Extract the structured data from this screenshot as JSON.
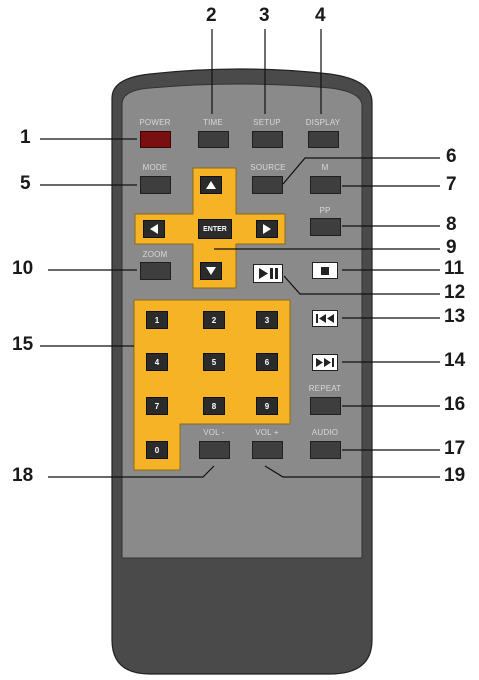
{
  "remote": {
    "buttons": {
      "power": "POWER",
      "time": "TIME",
      "setup": "SETUP",
      "display": "DISPLAY",
      "mode": "MODE",
      "source": "SOURCE",
      "m": "M",
      "pp": "PP",
      "zoom": "ZOOM",
      "enter": "ENTER",
      "repeat": "REPEAT",
      "audio": "AUDIO",
      "vol_minus": "VOL -",
      "vol_plus": "VOL +"
    },
    "keypad": [
      "1",
      "2",
      "3",
      "4",
      "5",
      "6",
      "7",
      "8",
      "9",
      "0"
    ],
    "icons": {
      "up": "arrow-up-icon",
      "down": "arrow-down-icon",
      "left": "arrow-left-icon",
      "right": "arrow-right-icon",
      "play_pause": "play-pause-icon",
      "stop": "stop-icon",
      "prev": "previous-track-icon",
      "next": "next-track-icon"
    },
    "colors": {
      "body": "#4a4a4a",
      "face": "#8a8a8a",
      "accent": "#f5b325",
      "power": "#7a0f12"
    }
  },
  "callouts": {
    "n1": "1",
    "n2": "2",
    "n3": "3",
    "n4": "4",
    "n5": "5",
    "n6": "6",
    "n7": "7",
    "n8": "8",
    "n9": "9",
    "n10": "10",
    "n11": "11",
    "n12": "12",
    "n13": "13",
    "n14": "14",
    "n15": "15",
    "n16": "16",
    "n17": "17",
    "n18": "18",
    "n19": "19"
  }
}
